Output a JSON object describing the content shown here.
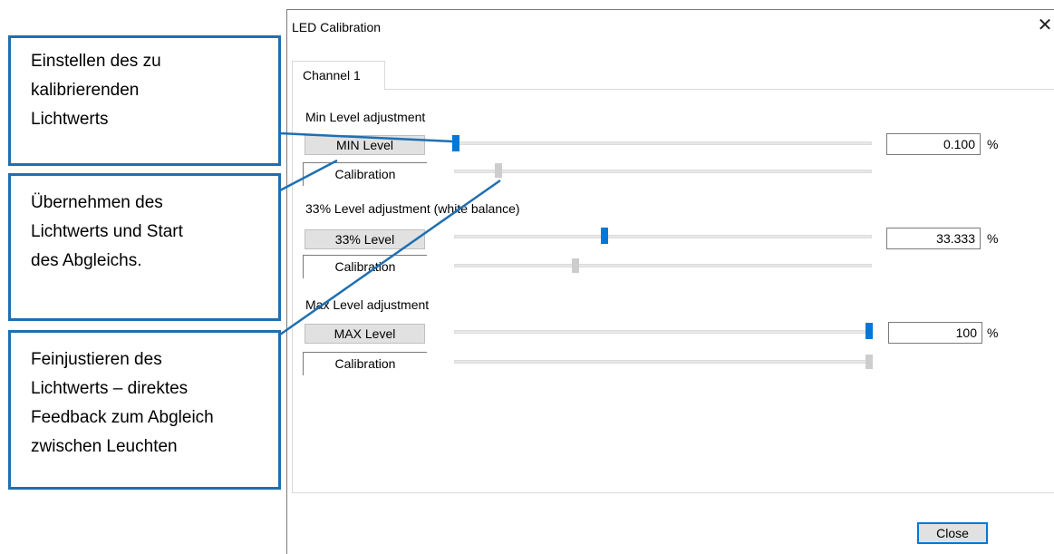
{
  "dialog": {
    "title": "LED Calibration",
    "close_glyph": "✕",
    "tab_label": "Channel 1",
    "close_button_label": "Close"
  },
  "sections": [
    {
      "heading": "Min Level adjustment",
      "button_label": "MIN Level",
      "calibration_label": "Calibration",
      "value": "0.100",
      "unit": "%",
      "slider_value_percent": 0.1
    },
    {
      "heading": "33% Level adjustment (white balance)",
      "button_label": "33% Level",
      "calibration_label": "Calibration",
      "value": "33.333",
      "unit": "%",
      "slider_value_percent": 33.333
    },
    {
      "heading": "Max Level adjustment",
      "button_label": "MAX Level",
      "calibration_label": "Calibration",
      "value": "100",
      "unit": "%",
      "slider_value_percent": 100
    }
  ],
  "callouts": [
    {
      "text_lines": [
        "Einstellen des zu",
        "kalibrierenden",
        "Lichtwerts"
      ]
    },
    {
      "text_lines": [
        "Übernehmen des",
        "Lichtwerts und Start",
        "des Abgleichs."
      ]
    },
    {
      "text_lines": [
        "Feinjustieren des",
        "Lichtwerts – direktes",
        "Feedback zum Abgleich",
        "zwischen Leuchten"
      ]
    }
  ],
  "colors": {
    "accent": "#0078d7",
    "callout_border": "#1f6fb2",
    "button_bg": "#e1e1e1"
  }
}
